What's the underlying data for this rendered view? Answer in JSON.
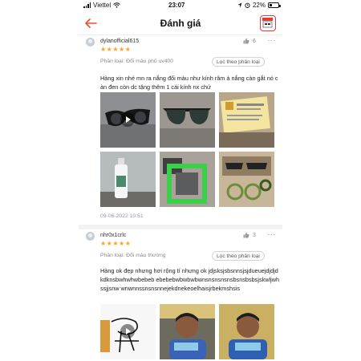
{
  "status_bar": {
    "carrier": "Viettel",
    "time": "23:07",
    "battery": "22%"
  },
  "header": {
    "title": "Đánh giá",
    "back_icon": "arrow-left-icon",
    "shop_icon": "shop-icon"
  },
  "colors": {
    "accent": "#ee4d2d",
    "star": "#f5a623"
  },
  "reviews": [
    {
      "username": "dylanofficial615",
      "stars": "★★★★★",
      "likes": "6",
      "more": "···",
      "variant": "Phân loại: Đổi màu phủ uv400",
      "filter": "Lọc theo phân loại",
      "comment": "Hàng xin nhé mn ra nắng đổi màu như kính râm á nắng càn gắt nó càn đen còn dc tặng thêm 1 cái kính nx chứ",
      "date": "09-06-2022 10:51"
    },
    {
      "username": "nhr0x1crlc",
      "stars": "★★★★★",
      "likes": "3",
      "more": "···",
      "variant": "Phân loại: Đổi màu thường",
      "filter": "Lọc theo phân loại",
      "comment": "Hàng ok đẹp nhưng hơi rộng tí nhưng ok jdjsksjsbsnnsjsjdueuejdjdjdkdknsbwhwhwbebeb ebebebwbwbwbwnsnsnsnsnsbsnsbsbsjskwljwhssjjsnw wnwnnssnsnsnnejekdnekeoelhaisjrbekmshsis"
    }
  ]
}
